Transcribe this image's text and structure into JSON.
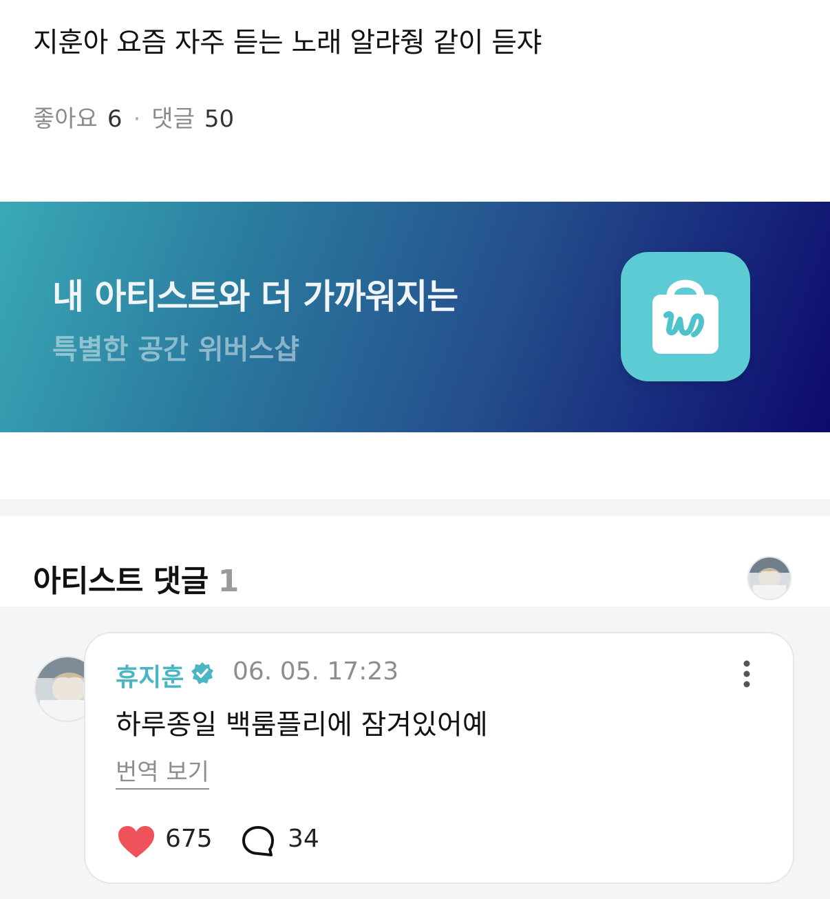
{
  "post": {
    "text": "지훈아 요즘 자주 듣는 노래 알랴줭 같이 듣쟈",
    "likes_label": "좋아요",
    "likes_count": "6",
    "separator": "·",
    "comments_label": "댓글",
    "comments_count": "50"
  },
  "banner": {
    "title": "내 아티스트와 더 가까워지는",
    "subtitle": "특별한 공간 위버스샵",
    "icon": "weverse-shop-bag-icon",
    "colors": {
      "gradient_start": "#3aa9b6",
      "gradient_end": "#0d0a6b",
      "icon_bg": "#5ccbd3"
    }
  },
  "artist_comments": {
    "title": "아티스트 댓글",
    "count": "1",
    "comment": {
      "author": "휴지훈",
      "verified_icon": "verified-badge-icon",
      "timestamp": "06. 05. 17:23",
      "text": "하루종일 백룸플리에 잠겨있어예",
      "translate_label": "번역 보기",
      "likes": "675",
      "replies": "34",
      "colors": {
        "author": "#4ab6c4",
        "heart": "#f0525b"
      }
    }
  }
}
